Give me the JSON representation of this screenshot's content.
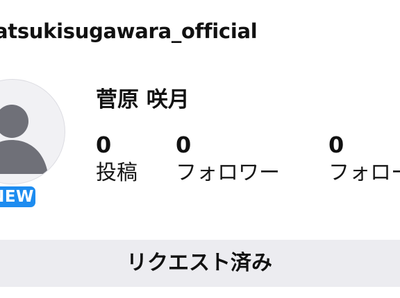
{
  "profile": {
    "username": "atsukisugawara_official",
    "display_name": "菅原 咲月",
    "badge": "NEW"
  },
  "stats": {
    "posts": {
      "count": "0",
      "label": "投稿"
    },
    "followers": {
      "count": "0",
      "label": "フォロワー"
    },
    "following": {
      "count": "0",
      "label": "フォロー"
    }
  },
  "actions": {
    "request_label": "リクエスト済み"
  },
  "icons": {
    "avatar": "default-user-avatar-icon"
  },
  "colors": {
    "badge_blue": "#1d8cf0",
    "button_gray": "#ececf0"
  }
}
